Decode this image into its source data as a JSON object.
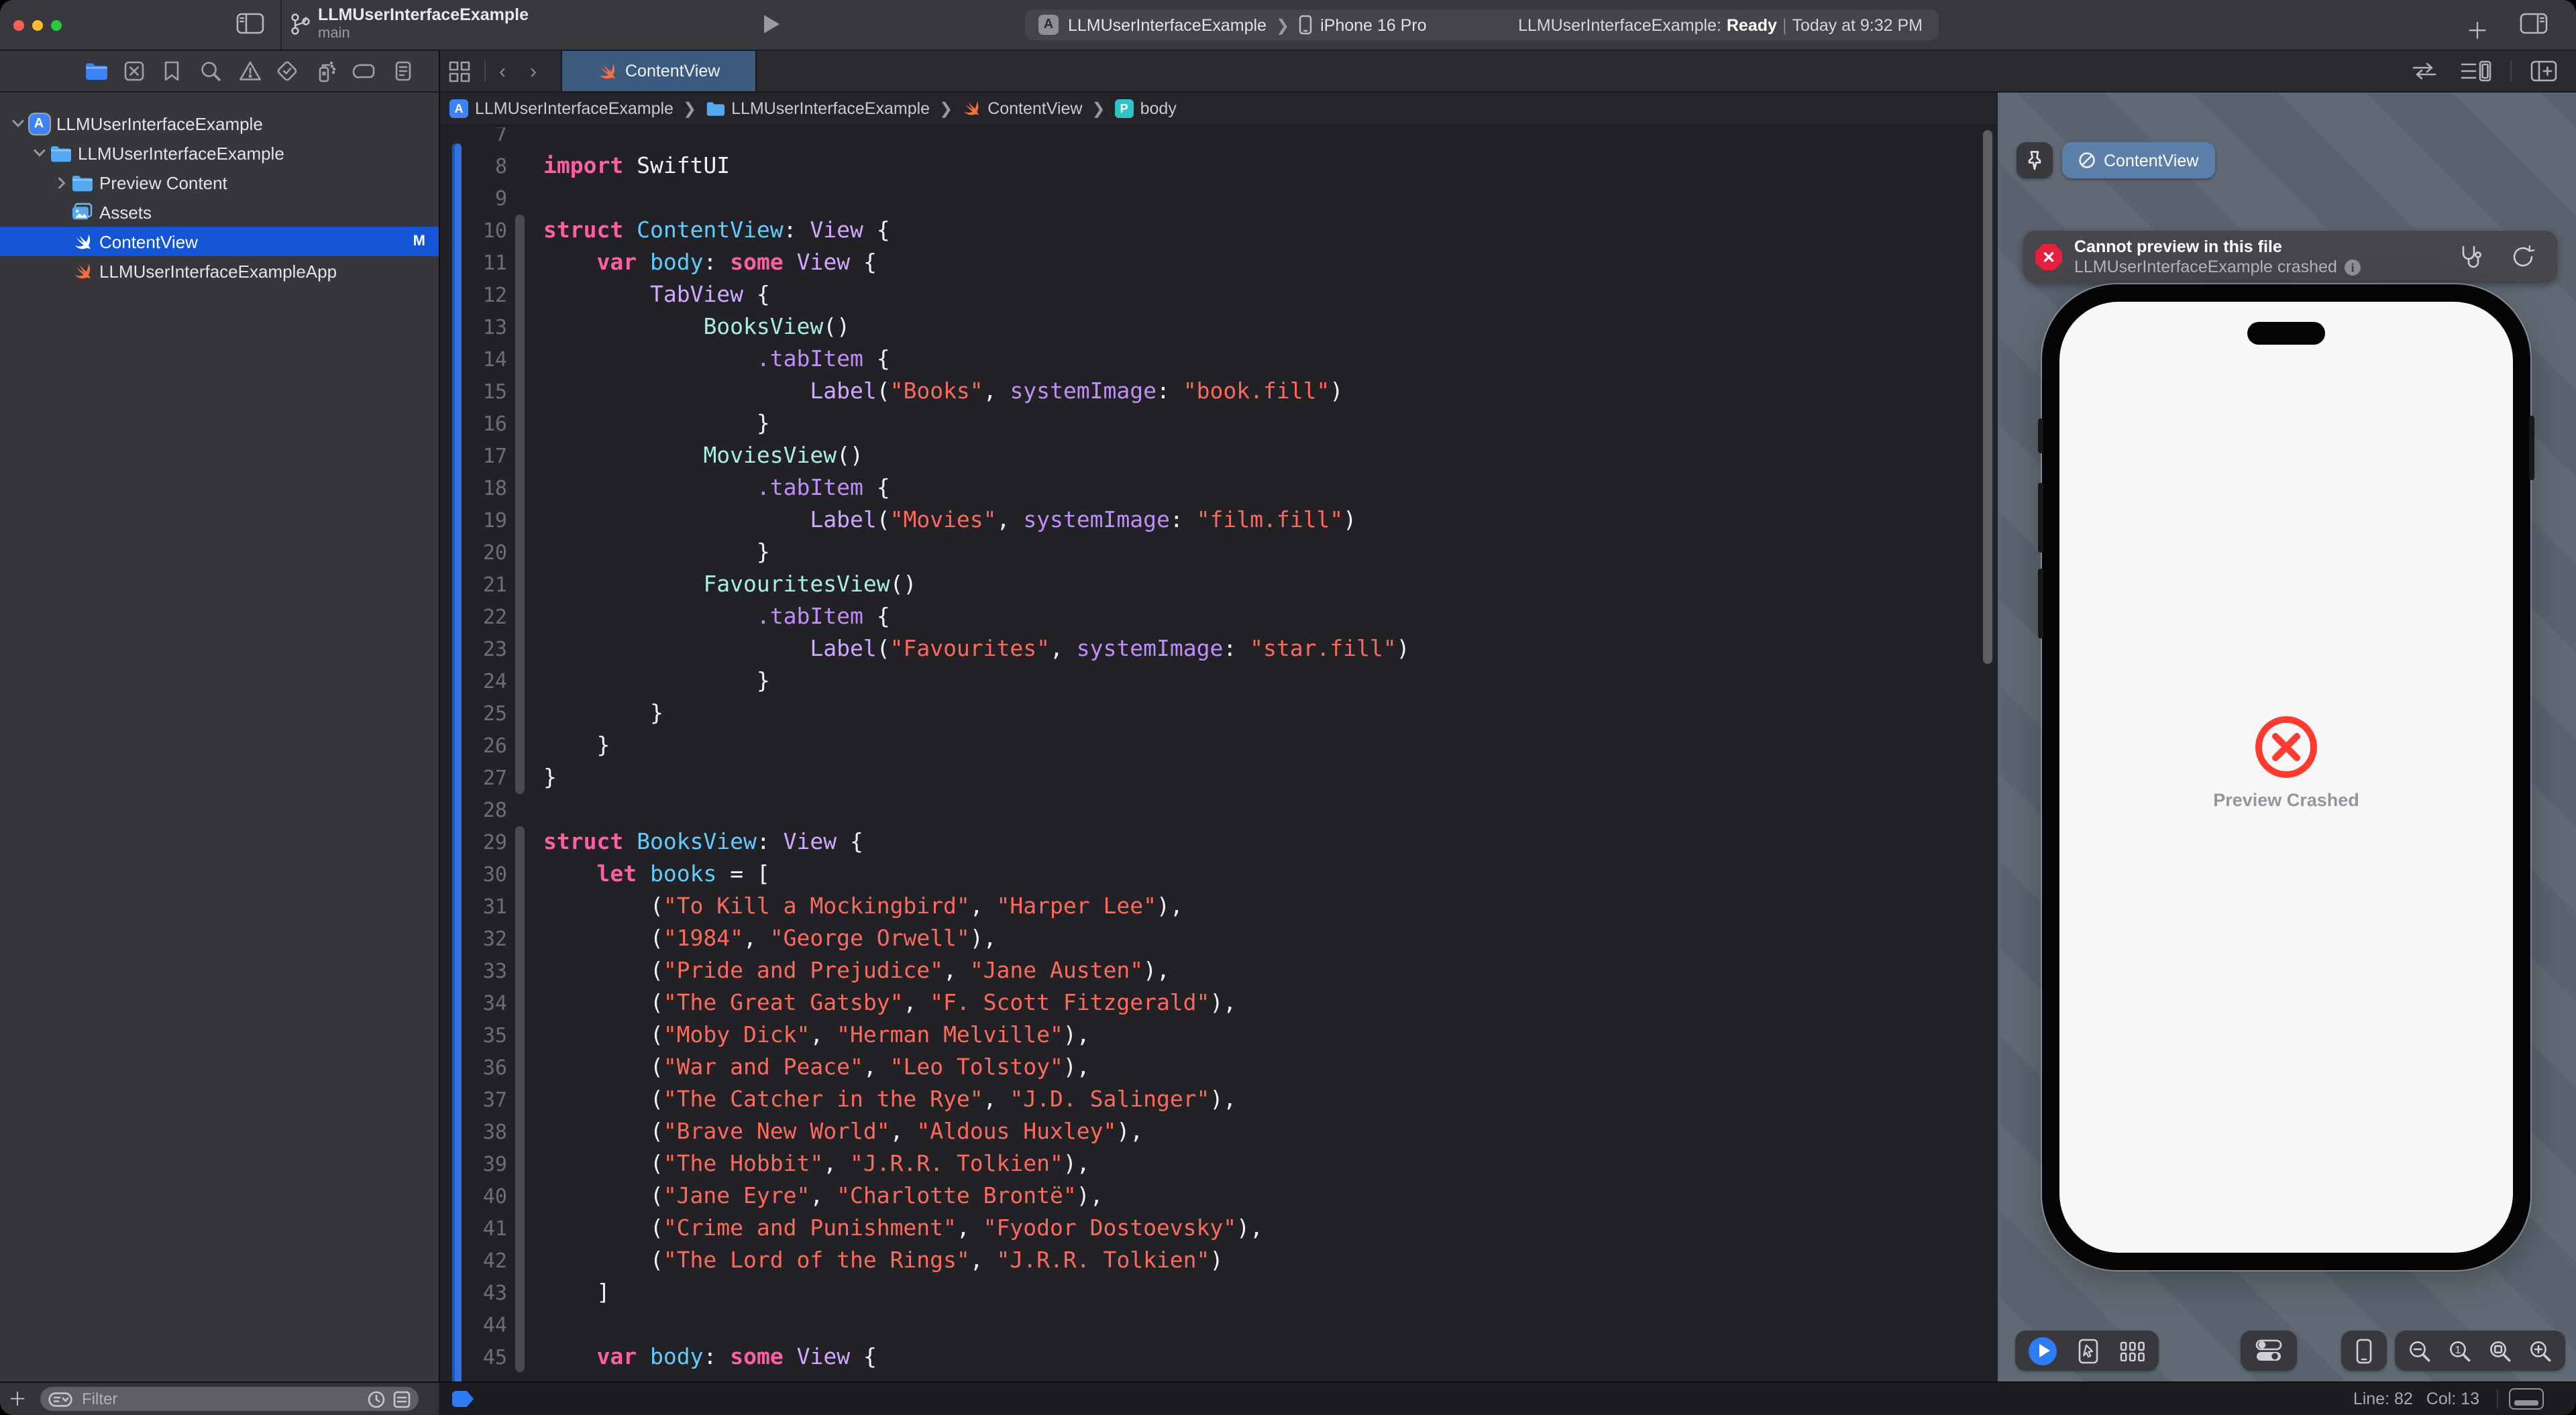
{
  "window": {
    "title": "LLMUserInterfaceExample",
    "branch": "main",
    "scheme_name": "LLMUserInterfaceExample",
    "scheme_device": "iPhone 16 Pro",
    "status_project": "LLMUserInterfaceExample:",
    "status_state": "Ready",
    "status_sep": "|",
    "status_time": "Today at 9:32 PM",
    "traffic_lights": [
      "close",
      "minimize",
      "zoom"
    ]
  },
  "navigator": {
    "icons": [
      "project-navigator",
      "source-control-navigator",
      "bookmarks-navigator",
      "find-navigator",
      "issues-navigator",
      "tests-navigator",
      "debug-navigator",
      "breakpoints-navigator",
      "reports-navigator"
    ],
    "tree": [
      {
        "icon": "app",
        "label": "LLMUserInterfaceExample",
        "chev": "v",
        "indent": 0,
        "selected": false,
        "badge": ""
      },
      {
        "icon": "folder",
        "label": "LLMUserInterfaceExample",
        "chev": "v",
        "indent": 1,
        "selected": false,
        "badge": ""
      },
      {
        "icon": "folder",
        "label": "Preview Content",
        "chev": ">",
        "indent": 2,
        "selected": false,
        "badge": ""
      },
      {
        "icon": "assets",
        "label": "Assets",
        "chev": "",
        "indent": 2,
        "selected": false,
        "badge": ""
      },
      {
        "icon": "swift-white",
        "label": "ContentView",
        "chev": "",
        "indent": 2,
        "selected": true,
        "badge": "M"
      },
      {
        "icon": "swift",
        "label": "LLMUserInterfaceExampleApp",
        "chev": "",
        "indent": 2,
        "selected": false,
        "badge": ""
      }
    ],
    "filter_placeholder": "Filter"
  },
  "tabbar": {
    "active_tab": "ContentView"
  },
  "jumpbar": {
    "items": [
      {
        "icon": "app",
        "label": "LLMUserInterfaceExample"
      },
      {
        "icon": "folder",
        "label": "LLMUserInterfaceExample"
      },
      {
        "icon": "swift",
        "label": "ContentView"
      },
      {
        "icon": "pbadge",
        "label": "body"
      }
    ]
  },
  "editor": {
    "lines": [
      {
        "n": 7,
        "t": []
      },
      {
        "n": 8,
        "t": [
          [
            "k",
            "import"
          ],
          [
            "p",
            " SwiftUI"
          ]
        ]
      },
      {
        "n": 9,
        "t": []
      },
      {
        "n": 10,
        "t": [
          [
            "k",
            "struct"
          ],
          [
            "p",
            " "
          ],
          [
            "d",
            "ContentView"
          ],
          [
            "p",
            ": "
          ],
          [
            "y",
            "View"
          ],
          [
            "p",
            " {"
          ]
        ]
      },
      {
        "n": 11,
        "t": [
          [
            "p",
            "    "
          ],
          [
            "k",
            "var"
          ],
          [
            "p",
            " "
          ],
          [
            "d",
            "body"
          ],
          [
            "p",
            ": "
          ],
          [
            "k",
            "some"
          ],
          [
            "p",
            " "
          ],
          [
            "y",
            "View"
          ],
          [
            "p",
            " {"
          ]
        ]
      },
      {
        "n": 12,
        "t": [
          [
            "p",
            "        "
          ],
          [
            "y",
            "TabView"
          ],
          [
            "p",
            " {"
          ]
        ]
      },
      {
        "n": 13,
        "t": [
          [
            "p",
            "            "
          ],
          [
            "f",
            "BooksView"
          ],
          [
            "p",
            "()"
          ]
        ]
      },
      {
        "n": 14,
        "t": [
          [
            "p",
            "                "
          ],
          [
            "m",
            ".tabItem"
          ],
          [
            "p",
            " {"
          ]
        ]
      },
      {
        "n": 15,
        "t": [
          [
            "p",
            "                    "
          ],
          [
            "y",
            "Label"
          ],
          [
            "p",
            "("
          ],
          [
            "s",
            "\"Books\""
          ],
          [
            "p",
            ", "
          ],
          [
            "m",
            "systemImage"
          ],
          [
            "p",
            ": "
          ],
          [
            "s",
            "\"book.fill\""
          ],
          [
            "p",
            ")"
          ]
        ]
      },
      {
        "n": 16,
        "t": [
          [
            "p",
            "                }"
          ]
        ]
      },
      {
        "n": 17,
        "t": [
          [
            "p",
            "            "
          ],
          [
            "f",
            "MoviesView"
          ],
          [
            "p",
            "()"
          ]
        ]
      },
      {
        "n": 18,
        "t": [
          [
            "p",
            "                "
          ],
          [
            "m",
            ".tabItem"
          ],
          [
            "p",
            " {"
          ]
        ]
      },
      {
        "n": 19,
        "t": [
          [
            "p",
            "                    "
          ],
          [
            "y",
            "Label"
          ],
          [
            "p",
            "("
          ],
          [
            "s",
            "\"Movies\""
          ],
          [
            "p",
            ", "
          ],
          [
            "m",
            "systemImage"
          ],
          [
            "p",
            ": "
          ],
          [
            "s",
            "\"film.fill\""
          ],
          [
            "p",
            ")"
          ]
        ]
      },
      {
        "n": 20,
        "t": [
          [
            "p",
            "                }"
          ]
        ]
      },
      {
        "n": 21,
        "t": [
          [
            "p",
            "            "
          ],
          [
            "f",
            "FavouritesView"
          ],
          [
            "p",
            "()"
          ]
        ]
      },
      {
        "n": 22,
        "t": [
          [
            "p",
            "                "
          ],
          [
            "m",
            ".tabItem"
          ],
          [
            "p",
            " {"
          ]
        ]
      },
      {
        "n": 23,
        "t": [
          [
            "p",
            "                    "
          ],
          [
            "y",
            "Label"
          ],
          [
            "p",
            "("
          ],
          [
            "s",
            "\"Favourites\""
          ],
          [
            "p",
            ", "
          ],
          [
            "m",
            "systemImage"
          ],
          [
            "p",
            ": "
          ],
          [
            "s",
            "\"star.fill\""
          ],
          [
            "p",
            ")"
          ]
        ]
      },
      {
        "n": 24,
        "t": [
          [
            "p",
            "                }"
          ]
        ]
      },
      {
        "n": 25,
        "t": [
          [
            "p",
            "        }"
          ]
        ]
      },
      {
        "n": 26,
        "t": [
          [
            "p",
            "    }"
          ]
        ]
      },
      {
        "n": 27,
        "t": [
          [
            "p",
            "}"
          ]
        ]
      },
      {
        "n": 28,
        "t": []
      },
      {
        "n": 29,
        "t": [
          [
            "k",
            "struct"
          ],
          [
            "p",
            " "
          ],
          [
            "d",
            "BooksView"
          ],
          [
            "p",
            ": "
          ],
          [
            "y",
            "View"
          ],
          [
            "p",
            " {"
          ]
        ]
      },
      {
        "n": 30,
        "t": [
          [
            "p",
            "    "
          ],
          [
            "k",
            "let"
          ],
          [
            "p",
            " "
          ],
          [
            "d",
            "books"
          ],
          [
            "p",
            " = ["
          ]
        ]
      },
      {
        "n": 31,
        "t": [
          [
            "p",
            "        ("
          ],
          [
            "s",
            "\"To Kill a Mockingbird\""
          ],
          [
            "p",
            ", "
          ],
          [
            "s",
            "\"Harper Lee\""
          ],
          [
            "p",
            "),"
          ]
        ]
      },
      {
        "n": 32,
        "t": [
          [
            "p",
            "        ("
          ],
          [
            "s",
            "\"1984\""
          ],
          [
            "p",
            ", "
          ],
          [
            "s",
            "\"George Orwell\""
          ],
          [
            "p",
            "),"
          ]
        ]
      },
      {
        "n": 33,
        "t": [
          [
            "p",
            "        ("
          ],
          [
            "s",
            "\"Pride and Prejudice\""
          ],
          [
            "p",
            ", "
          ],
          [
            "s",
            "\"Jane Austen\""
          ],
          [
            "p",
            "),"
          ]
        ]
      },
      {
        "n": 34,
        "t": [
          [
            "p",
            "        ("
          ],
          [
            "s",
            "\"The Great Gatsby\""
          ],
          [
            "p",
            ", "
          ],
          [
            "s",
            "\"F. Scott Fitzgerald\""
          ],
          [
            "p",
            "),"
          ]
        ]
      },
      {
        "n": 35,
        "t": [
          [
            "p",
            "        ("
          ],
          [
            "s",
            "\"Moby Dick\""
          ],
          [
            "p",
            ", "
          ],
          [
            "s",
            "\"Herman Melville\""
          ],
          [
            "p",
            "),"
          ]
        ]
      },
      {
        "n": 36,
        "t": [
          [
            "p",
            "        ("
          ],
          [
            "s",
            "\"War and Peace\""
          ],
          [
            "p",
            ", "
          ],
          [
            "s",
            "\"Leo Tolstoy\""
          ],
          [
            "p",
            "),"
          ]
        ]
      },
      {
        "n": 37,
        "t": [
          [
            "p",
            "        ("
          ],
          [
            "s",
            "\"The Catcher in the Rye\""
          ],
          [
            "p",
            ", "
          ],
          [
            "s",
            "\"J.D. Salinger\""
          ],
          [
            "p",
            "),"
          ]
        ]
      },
      {
        "n": 38,
        "t": [
          [
            "p",
            "        ("
          ],
          [
            "s",
            "\"Brave New World\""
          ],
          [
            "p",
            ", "
          ],
          [
            "s",
            "\"Aldous Huxley\""
          ],
          [
            "p",
            "),"
          ]
        ]
      },
      {
        "n": 39,
        "t": [
          [
            "p",
            "        ("
          ],
          [
            "s",
            "\"The Hobbit\""
          ],
          [
            "p",
            ", "
          ],
          [
            "s",
            "\"J.R.R. Tolkien\""
          ],
          [
            "p",
            "),"
          ]
        ]
      },
      {
        "n": 40,
        "t": [
          [
            "p",
            "        ("
          ],
          [
            "s",
            "\"Jane Eyre\""
          ],
          [
            "p",
            ", "
          ],
          [
            "s",
            "\"Charlotte Brontë\""
          ],
          [
            "p",
            "),"
          ]
        ]
      },
      {
        "n": 41,
        "t": [
          [
            "p",
            "        ("
          ],
          [
            "s",
            "\"Crime and Punishment\""
          ],
          [
            "p",
            ", "
          ],
          [
            "s",
            "\"Fyodor Dostoevsky\""
          ],
          [
            "p",
            "),"
          ]
        ]
      },
      {
        "n": 42,
        "t": [
          [
            "p",
            "        ("
          ],
          [
            "s",
            "\"The Lord of the Rings\""
          ],
          [
            "p",
            ", "
          ],
          [
            "s",
            "\"J.R.R. Tolkien\""
          ],
          [
            "p",
            ")"
          ]
        ]
      },
      {
        "n": 43,
        "t": [
          [
            "p",
            "    ]"
          ]
        ]
      },
      {
        "n": 44,
        "t": []
      },
      {
        "n": 45,
        "t": [
          [
            "p",
            "    "
          ],
          [
            "k",
            "var"
          ],
          [
            "p",
            " "
          ],
          [
            "d",
            "body"
          ],
          [
            "p",
            ": "
          ],
          [
            "k",
            "some"
          ],
          [
            "p",
            " "
          ],
          [
            "y",
            "View"
          ],
          [
            "p",
            " {"
          ]
        ]
      }
    ]
  },
  "statusbar": {
    "line": "Line: 82",
    "col": "Col: 13"
  },
  "canvas": {
    "preview_pill": "ContentView",
    "banner_title": "Cannot preview in this file",
    "banner_subtitle": "LLMUserInterfaceExample crashed",
    "crash_label": "Preview Crashed"
  },
  "colors": {
    "selection_blue": "#1355d4",
    "accent_blue": "#2e7bf6",
    "tab_blue": "#3c5a7e",
    "preview_pill_blue": "#5c80aa",
    "canvas_gray": "#5a636e",
    "error_red": "#e5203f",
    "crash_red": "#ff3b30",
    "keyword_pink": "#fc5fa3",
    "string_red": "#fc6a5d",
    "type_lavender": "#d0a8ff",
    "decl_cyan": "#5fcdff",
    "call_mint": "#a8f0dc"
  }
}
